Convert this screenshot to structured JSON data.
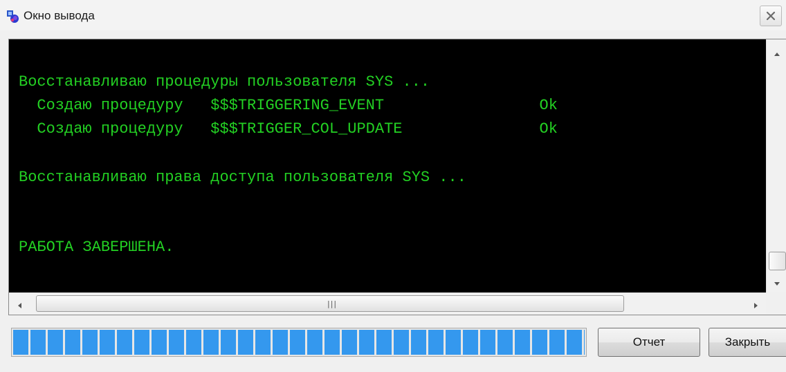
{
  "window": {
    "title": "Окно вывода"
  },
  "console": {
    "lines": [
      "Восстанавливаю процедуры пользователя SYS ...",
      "  Создаю процедуру   $$$TRIGGERING_EVENT                 Ok",
      "  Создаю процедуру   $$$TRIGGER_COL_UPDATE               Ok",
      "",
      "Восстанавливаю права доступа пользователя SYS ...",
      "",
      "",
      "РАБОТА ЗАВЕРШЕНА."
    ],
    "text_color": "#23d023",
    "background": "#000000"
  },
  "progress": {
    "value_percent": 100,
    "color": "#3498ee"
  },
  "buttons": {
    "report_label": "Отчет",
    "close_label": "Закрыть"
  },
  "icons": {
    "app": "app-window-icon",
    "close": "close-x-icon",
    "scroll_up": "triangle-up-icon",
    "scroll_down": "triangle-down-icon",
    "scroll_left": "triangle-left-icon",
    "scroll_right": "triangle-right-icon"
  }
}
